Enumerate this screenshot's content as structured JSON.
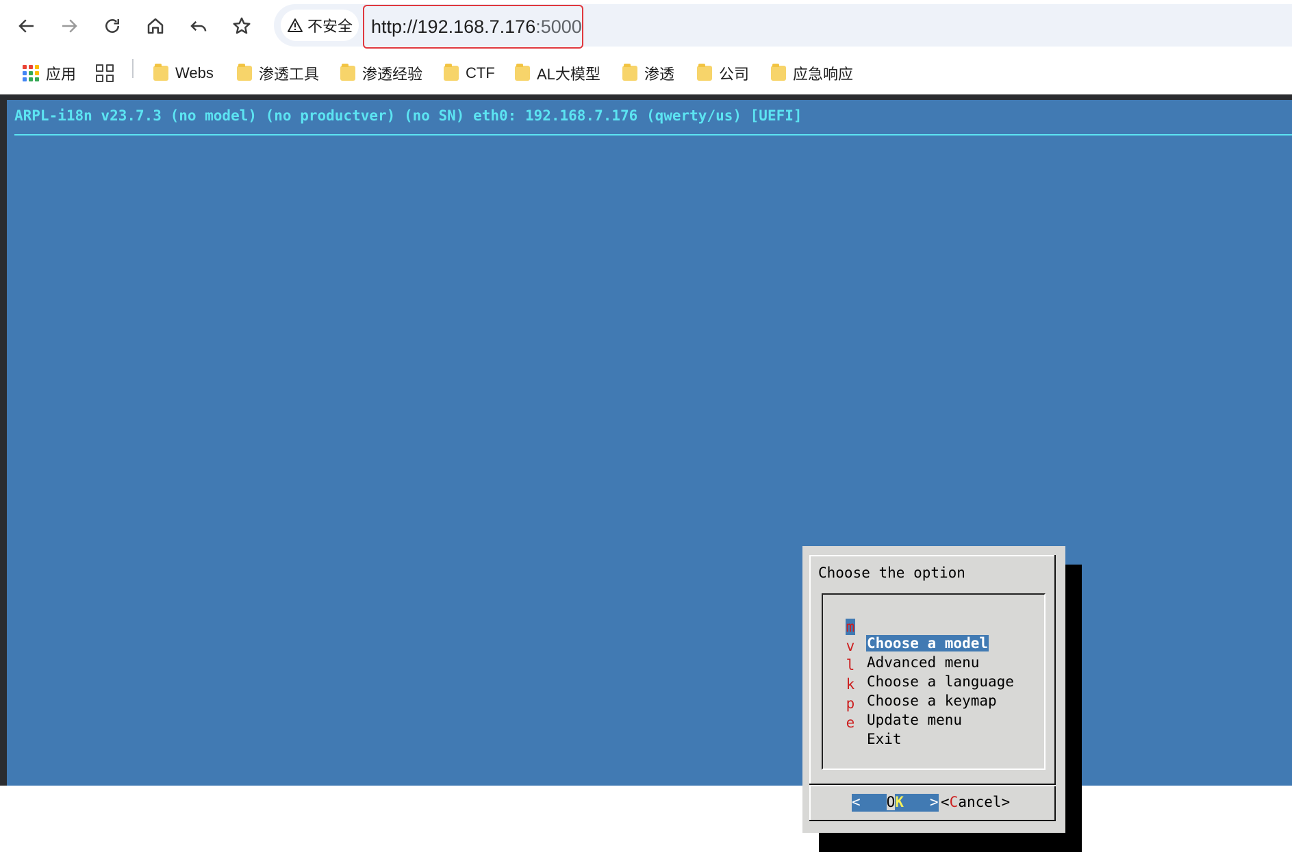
{
  "browser": {
    "security_label": "不安全",
    "url_host": "http://192.168.7.176",
    "url_port": ":5000",
    "bookmarks": [
      "应用",
      "Webs",
      "渗透工具",
      "渗透经验",
      "CTF",
      "AL大模型",
      "渗透",
      "公司",
      "应急响应"
    ]
  },
  "terminal": {
    "backtitle": "ARPL-i18n v23.7.3 (no model) (no productver) (no SN) eth0: 192.168.7.176 (qwerty/us) [UEFI]",
    "dialog": {
      "title": "Choose the option",
      "items": [
        {
          "key": "m",
          "label": "Choose a model",
          "selected": true
        },
        {
          "key": "v",
          "label": "Advanced menu"
        },
        {
          "key": "l",
          "label": "Choose a language"
        },
        {
          "key": "k",
          "label": "Choose a keymap"
        },
        {
          "key": "p",
          "label": "Update menu"
        },
        {
          "key": "e",
          "label": "Exit"
        }
      ],
      "ok_button": {
        "left": "<",
        "first": "O",
        "hot": "K",
        "right": ">"
      },
      "cancel_button": {
        "open": "<",
        "hot": "C",
        "rest": "ancel",
        "close": ">"
      }
    }
  },
  "colors": {
    "terminal_bg": "#417ab3",
    "backtitle": "#5ce4f2",
    "dialog_bg": "#d8d8d6",
    "hotkey": "#cc1f1f",
    "url_border": "#e0383e"
  }
}
